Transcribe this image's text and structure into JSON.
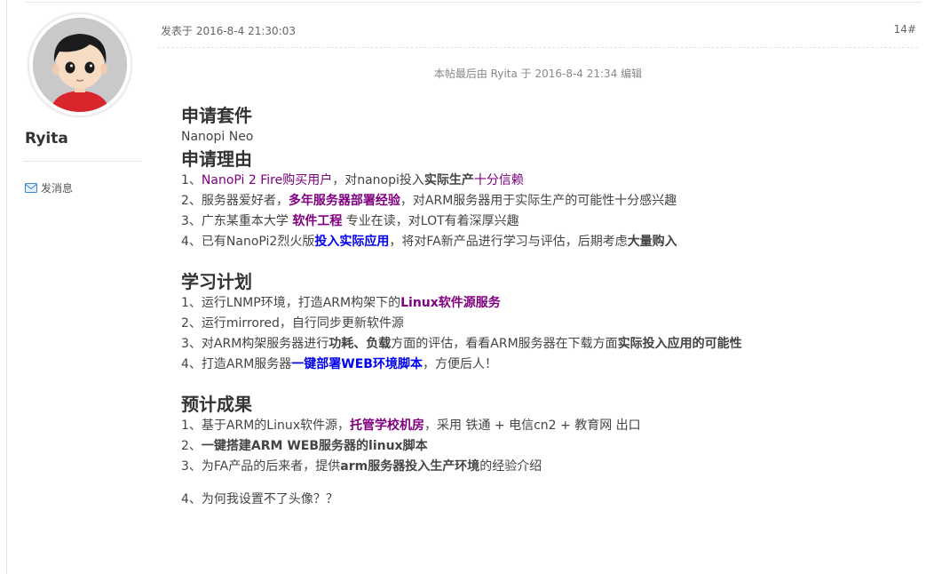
{
  "user": {
    "name": "Ryita",
    "send_message": "发消息"
  },
  "post": {
    "posted_at": "发表于 2016-8-4 21:30:03",
    "floor": "14#",
    "edit_note": "本帖最后由 Ryita 于 2016-8-4 21:34 编辑"
  },
  "sections": {
    "apply_kit": {
      "title": "申请套件",
      "value": "Nanopi Neo"
    },
    "reasons": {
      "title": "申请理由",
      "r1": {
        "num": "1、",
        "link": "NanoPi 2 Fire购买用户",
        "a": "，对nanopi投入",
        "bold": "实际生产",
        "end": "十分信赖"
      },
      "r2": {
        "a": "2、服务器爱好者，",
        "bold": "多年服务器部署经验",
        "end": "，对ARM服务器用于实际生产的可能性十分感兴趣"
      },
      "r3": {
        "a": "3、广东某重本大学 ",
        "bold": "软件工程",
        "end": " 专业在读，对LOT有着深厚兴趣"
      },
      "r4": {
        "a": "4、已有NanoPi2烈火版",
        "bold": "投入实际应用",
        "mid": "，将对FA新产品进行学习与评估，后期考虑",
        "end": "大量购入"
      }
    },
    "plan": {
      "title": "学习计划",
      "p1": {
        "a": "1、运行LNMP环境，打造ARM构架下的",
        "bold": "Linux软件源服务"
      },
      "p2": {
        "a": "2、运行mirrored，自行同步更新软件源"
      },
      "p3": {
        "a": "3、对ARM构架服务器进行",
        "b1": "功耗、负载",
        "mid": "方面的评估，看看ARM服务器在下载方面",
        "b2": "实际投入应用的可能性"
      },
      "p4": {
        "a": "4、打造ARM服务器",
        "bold": "一键部署WEB环境脚本",
        "end": "，方便后人！"
      }
    },
    "results": {
      "title": "预计成果",
      "e1": {
        "a": "1、基于ARM的Linux软件源，",
        "bold": "托管学校机房",
        "end": "，采用 铁通 + 电信cn2 + 教育网 出口"
      },
      "e2": {
        "a": "2、",
        "bold": "一键搭建ARM WEB服务器的linux脚本"
      },
      "e3": {
        "a": "3、为FA产品的后来者，提供",
        "bold": "arm服务器投入生产环境",
        "end": "的经验介绍"
      },
      "e4": {
        "a": "4、为何我设置不了头像？？"
      }
    }
  },
  "colors": {
    "purple_link": "#800080",
    "blue_link": "#0000ee",
    "text": "#444444",
    "meta": "#666666"
  },
  "icons": {
    "mail": "mail-icon",
    "avatar": "cartoon-boy-avatar"
  }
}
